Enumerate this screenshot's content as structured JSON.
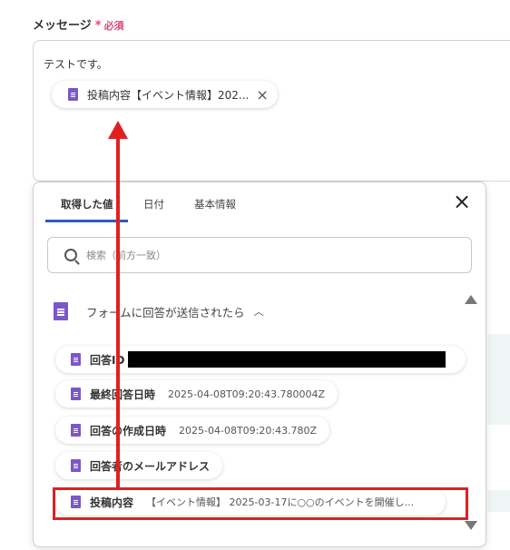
{
  "field": {
    "label": "メッセージ",
    "required_star": "*",
    "required_text": "必須"
  },
  "message": {
    "text": "テストです。",
    "token": {
      "label": "投稿内容【イベント情報】202...",
      "close_icon": "×"
    }
  },
  "popup": {
    "tabs": [
      "取得した値",
      "日付",
      "基本情報"
    ],
    "active_tab": 0,
    "close_icon": "×",
    "search": {
      "placeholder": "検索（前方一致）"
    },
    "group": {
      "title": "フォームに回答が送信されたら",
      "caret": "︿"
    },
    "items": [
      {
        "name": "回答ID",
        "value": ""
      },
      {
        "name": "最終回答日時",
        "value": "2025-04-08T09:20:43.780004Z"
      },
      {
        "name": "回答の作成日時",
        "value": "2025-04-08T09:20:43.780Z"
      },
      {
        "name": "回答者のメールアドレス",
        "value": ""
      },
      {
        "name": "投稿内容",
        "value": "【イベント情報】 2025-03-17に○○のイベントを開催し..."
      }
    ]
  },
  "colors": {
    "accent": "#2e5bb8",
    "required": "#e0457b",
    "doc_icon": "#7b57c9",
    "annotation": "#e02020"
  }
}
